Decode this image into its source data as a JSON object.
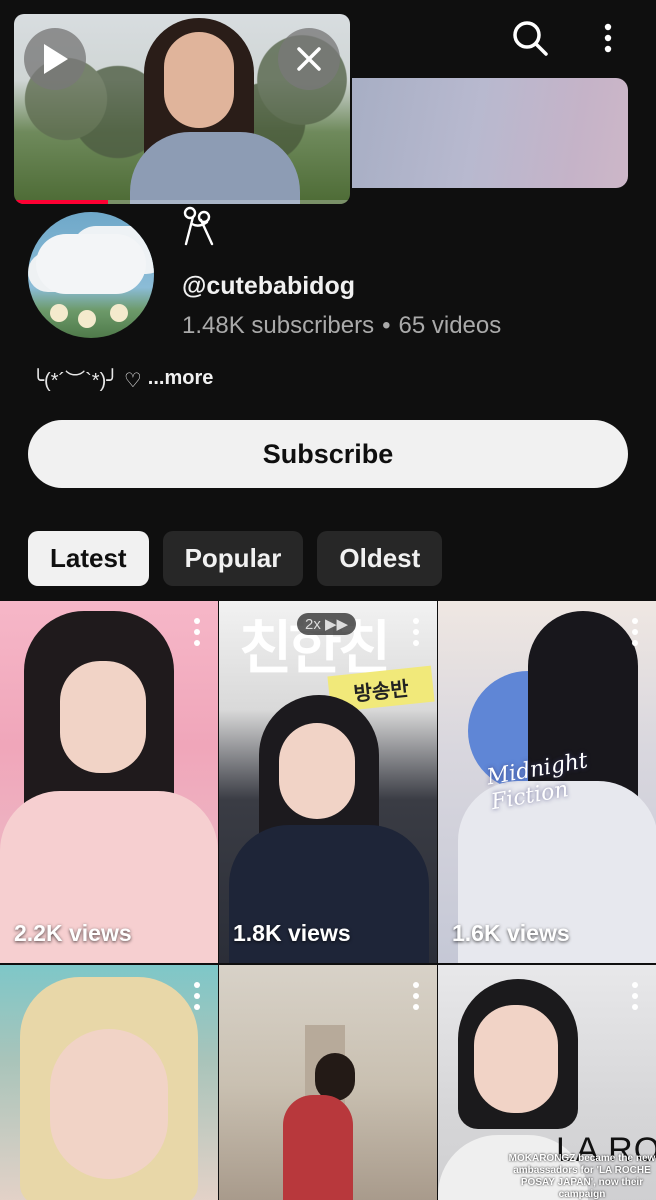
{
  "mini_player": {
    "progress": 0.28,
    "play_icon": "play-icon",
    "close_icon": "close-icon"
  },
  "top_bar": {
    "search_icon": "search-icon",
    "more_icon": "more-vertical-icon"
  },
  "channel": {
    "glyph": "scissors-like glyph",
    "handle": "@cutebabidog",
    "subscribers": "1.48K subscribers",
    "separator": "•",
    "videos": "65 videos",
    "description": "╰(*´︶`*)╯ ♡",
    "more_label": "...more"
  },
  "subscribe_label": "Subscribe",
  "chips": [
    {
      "label": "Latest",
      "active": true
    },
    {
      "label": "Popular",
      "active": false
    },
    {
      "label": "Oldest",
      "active": false
    }
  ],
  "videos": [
    {
      "views": "2.2K views"
    },
    {
      "views": "1.8K views",
      "speed_badge": "2x ▶▶",
      "sign_text": "방송반",
      "header_text": "친한친"
    },
    {
      "views": "1.6K views",
      "overlay_text": "Midnight Fiction"
    },
    {
      "views": ""
    },
    {
      "views": ""
    },
    {
      "views": "",
      "brand_text": "LA ROC",
      "caption": "MOKARONGZ became the new ambassadors for 'LA ROCHE POSAY JAPAN', now their campaign"
    }
  ],
  "colors": {
    "background": "#0f0f0f",
    "chip_active_bg": "#f1f1f1",
    "chip_bg": "#272727",
    "secondary_text": "#aaaaaa",
    "progress_red": "#ff0033"
  }
}
